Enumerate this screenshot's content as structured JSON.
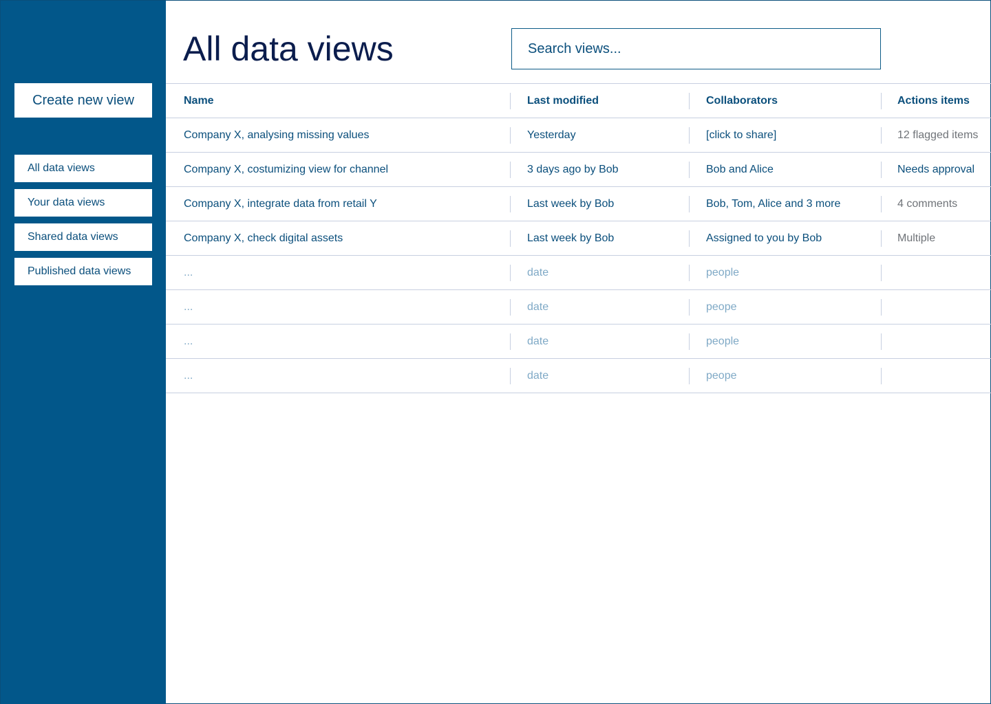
{
  "sidebar": {
    "create_button": "Create new view",
    "items": [
      {
        "label": "All data views"
      },
      {
        "label": "Your data views"
      },
      {
        "label": "Shared data views"
      },
      {
        "label": "Published data views"
      }
    ]
  },
  "header": {
    "title": "All data views",
    "search_placeholder": "Search views..."
  },
  "table": {
    "columns": [
      "Name",
      "Last modified",
      "Collaborators",
      "Actions items"
    ],
    "rows": [
      [
        "Company X, analysing missing values",
        "Yesterday",
        "[click to share]",
        "12 flagged items"
      ],
      [
        "Company X, costumizing view for channel",
        "3 days ago by Bob",
        "Bob and Alice",
        "Needs approval"
      ],
      [
        "Company X, integrate data from retail Y",
        "Last week by Bob",
        "Bob, Tom, Alice and 3 more",
        "4 comments"
      ],
      [
        "Company X, check digital assets",
        "Last week by Bob",
        "Assigned to you by Bob",
        "Multiple"
      ]
    ],
    "placeholder_rows": [
      [
        "...",
        "date",
        "people",
        ""
      ],
      [
        "...",
        "date",
        "peope",
        ""
      ],
      [
        "...",
        "date",
        "people",
        ""
      ],
      [
        "...",
        "date",
        "peope",
        ""
      ]
    ]
  },
  "colors": {
    "sidebar": "#02578a",
    "text": "#0b4f7c",
    "title": "#0b1d4d",
    "muted": "#7fa9c6",
    "divider": "#c7cfe0"
  }
}
